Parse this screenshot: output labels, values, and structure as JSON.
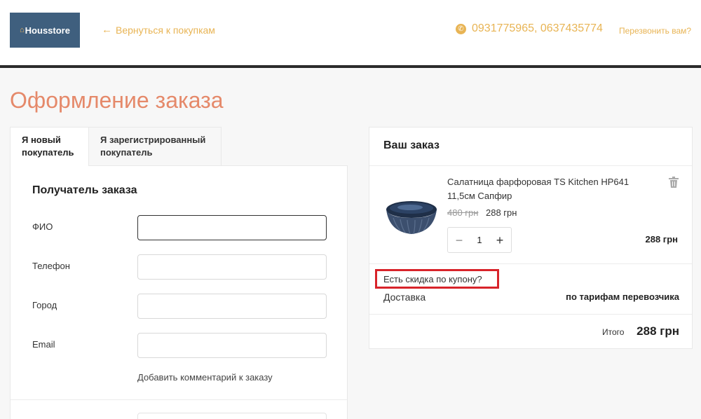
{
  "header": {
    "logo_text": "Housstore",
    "back_link": "Вернуться к покупкам",
    "phones": "0931775965,  0637435774",
    "callback": "Перезвонить вам?",
    "accent_color": "#e8b454"
  },
  "page_title": "Оформление заказа",
  "tabs": [
    {
      "label": "Я новый покупатель",
      "active": true
    },
    {
      "label": "Я зарегистрированный покупатель",
      "active": false
    }
  ],
  "form": {
    "title": "Получатель заказа",
    "fields": [
      {
        "label": "ФИО",
        "value": ""
      },
      {
        "label": "Телефон",
        "value": ""
      },
      {
        "label": "Город",
        "value": ""
      },
      {
        "label": "Email",
        "value": ""
      }
    ],
    "comment_link": "Добавить комментарий к заказу"
  },
  "order": {
    "title": "Ваш заказ",
    "item": {
      "name": "Салатница фарфоровая TS Kitchen HP641 11,5см Сапфир",
      "old_price": "480 грн",
      "price": "288 грн",
      "quantity": "1",
      "line_total": "288 грн"
    },
    "coupon_link": "Есть скидка по купону?",
    "delivery_label": "Доставка",
    "delivery_value": "по тарифам перевозчика",
    "total_label": "Итого",
    "total_value": "288 грн"
  },
  "icons": [
    "home-icon",
    "arrow-left-icon",
    "phone-icon",
    "trash-icon",
    "minus-icon",
    "plus-icon"
  ]
}
